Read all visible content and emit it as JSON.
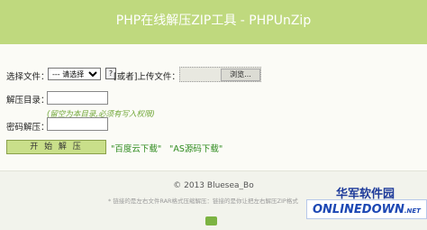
{
  "header": {
    "title": "PHP在线解压ZIP工具 - PHPUnZip"
  },
  "form": {
    "select_file_label": "选择文件：",
    "select_placeholder": "--- 请选择 ---",
    "help_label": "?",
    "or_upload_label": "[或者]上传文件：",
    "browse_label": "浏览...",
    "dir_label": "解压目录：",
    "dir_value": "",
    "dir_note": "(留空为本目录,必须有写入权限)",
    "password_label": "密码解压：",
    "password_value": "",
    "start_button": "开 始 解 压",
    "links": [
      "\"百度云下载\"",
      "\"AS源码下载\""
    ]
  },
  "footer": {
    "copyright": "© 2013 Bluesea_Bo",
    "tip": "* 链接的是左右文件RAR格式压缩解压：链接的是你让把左右解压ZIP格式"
  },
  "watermark": {
    "site_cn": "华军软件园",
    "logo_text": "ONLINEDOWN",
    "logo_suffix": ".NET"
  }
}
